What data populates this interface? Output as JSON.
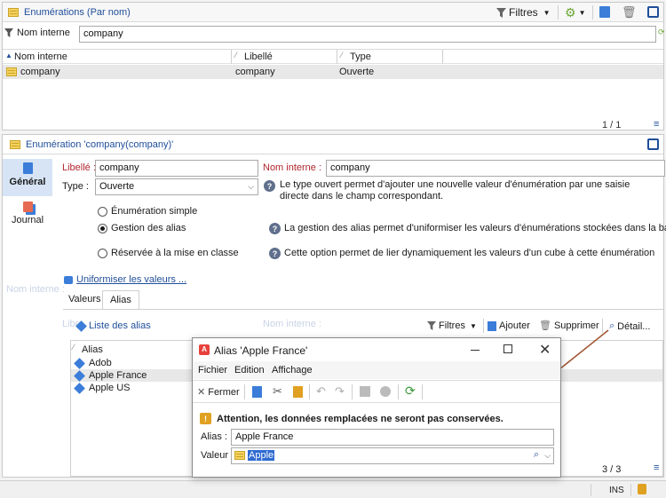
{
  "list_header": {
    "title": "Enumérations (Par nom)",
    "filters_label": "Filtres"
  },
  "filter": {
    "field_label": "Nom interne",
    "value": "company"
  },
  "table": {
    "columns": [
      "Nom interne",
      "Libellé",
      "Type"
    ],
    "rows": [
      {
        "name": "company",
        "label": "company",
        "type": "Ouverte"
      }
    ],
    "pagination": "1 / 1"
  },
  "detail": {
    "title": "Enumération 'company(company)'",
    "side_tabs": [
      "Général",
      "Journal"
    ],
    "libelle_label": "Libellé :",
    "libelle_value": "company",
    "nom_interne_label": "Nom interne :",
    "nom_interne_value": "company",
    "type_label": "Type :",
    "type_value": "Ouverte",
    "type_help": "Le type ouvert permet d'ajouter une nouvelle valeur d'énumération par une saisie directe dans le champ correspondant.",
    "radio_simple": "Énumération simple",
    "radio_alias": "Gestion des alias",
    "radio_alias_help": "La gestion des alias permet d'uniformiser les valeurs d'énumérations stockées dans la base.",
    "radio_cube": "Réservée à la mise en classe",
    "radio_cube_help": "Cette option permet de lier dynamiquement les valeurs d'un cube à cette énumération",
    "uniformize_link": "Uniformiser les valeurs ...",
    "tabs": [
      "Valeurs",
      "Alias"
    ],
    "alias_list_title": "Liste des alias",
    "alias_toolbar": {
      "filters": "Filtres",
      "add": "Ajouter",
      "delete": "Supprimer",
      "detail": "Détail..."
    },
    "alias_column": "Alias",
    "alias_items": [
      "Adob",
      "Apple France",
      "Apple US"
    ],
    "alias_pagination": "3 / 3"
  },
  "dialog": {
    "title": "Alias 'Apple France'",
    "menu": [
      "Fichier",
      "Edition",
      "Affichage"
    ],
    "close_label": "Fermer",
    "warning": "Attention, les données remplacées ne seront pas conservées.",
    "alias_label": "Alias :",
    "alias_value": "Apple France",
    "valeur_label": "Valeur :",
    "valeur_value": "Apple"
  },
  "statusbar": {
    "ins": "INS"
  },
  "ghost_text": {
    "nom_interne": "Nom interne :",
    "libelle": "Libe"
  }
}
